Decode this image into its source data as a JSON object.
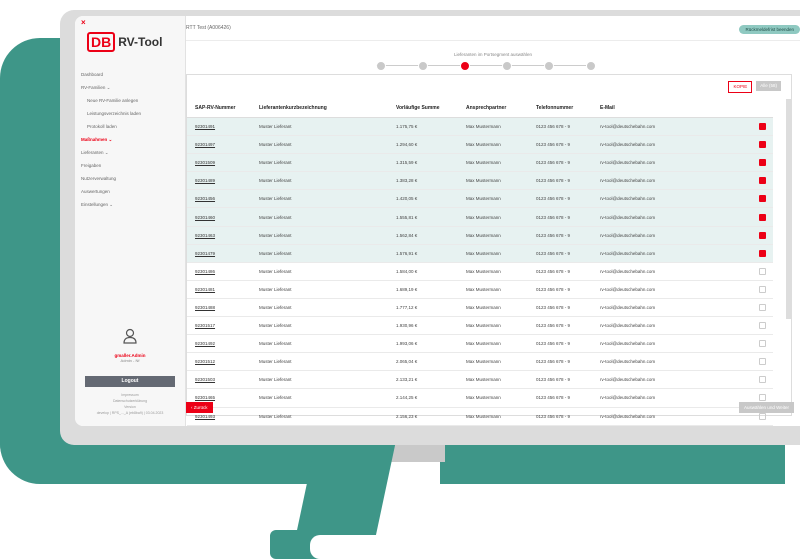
{
  "app": {
    "logo_mark": "DB",
    "logo_text": "RV-Tool",
    "close_glyph": "×"
  },
  "sidebar": {
    "items": [
      {
        "label": "Dashboard",
        "type": "main"
      },
      {
        "label": "RV-Familien ⌄",
        "type": "main"
      },
      {
        "label": "Neue RV-Familie anlegen",
        "type": "sub"
      },
      {
        "label": "Leistungsverzeichnis laden",
        "type": "sub"
      },
      {
        "label": "Protokoll laden",
        "type": "sub"
      },
      {
        "label": "Maßnahmen ⌄",
        "type": "active"
      },
      {
        "label": "Lieferanten ⌄",
        "type": "main"
      },
      {
        "label": "Freigaben",
        "type": "main"
      },
      {
        "label": "Nutzerverwaltung",
        "type": "main"
      },
      {
        "label": "Auswertungen",
        "type": "main"
      },
      {
        "label": "Einstellungen ⌄",
        "type": "main"
      }
    ],
    "user_name": "gmaller.Admin",
    "user_role": "Admin - Nf",
    "logout": "Logout",
    "footer_lines": [
      "Impressum",
      "Datenschutzerklärung",
      "Version",
      "develop | RPS_..._A (eb8ba9) | 03.04.2023"
    ]
  },
  "header": {
    "breadcrumb": "RTT Test (A006426)",
    "back_button": "Rückmeldefrist beenden"
  },
  "stepper": {
    "label": "Lieferanten im Portsegment auswählen",
    "active_step": 3,
    "total_steps": 6
  },
  "panel": {
    "btn_kopie": "KOPIE",
    "btn_alle": "Alle (58)"
  },
  "table": {
    "headers": [
      "SAP-RV-Nummer",
      "Lieferantenkurzbezeichnung",
      "Vorläufige Summe",
      "Ansprechpartner",
      "Telefonnummer",
      "E-Mail"
    ],
    "rows": [
      {
        "id": "92301491",
        "name": "Muster Lieferant",
        "sum": "1.175,75 €",
        "contact": "Max Mustermann",
        "phone": "0123 456 678 - 9",
        "email": "rv-tool@deutschebahn.com",
        "selected": true
      },
      {
        "id": "92301497",
        "name": "Muster Lieferant",
        "sum": "1.294,60 €",
        "contact": "Max Mustermann",
        "phone": "0123 456 678 - 9",
        "email": "rv-tool@deutschebahn.com",
        "selected": true
      },
      {
        "id": "92301509",
        "name": "Muster Lieferant",
        "sum": "1.315,59 €",
        "contact": "Max Mustermann",
        "phone": "0123 456 678 - 9",
        "email": "rv-tool@deutschebahn.com",
        "selected": true
      },
      {
        "id": "92301489",
        "name": "Muster Lieferant",
        "sum": "1.383,28 €",
        "contact": "Max Mustermann",
        "phone": "0123 456 678 - 9",
        "email": "rv-tool@deutschebahn.com",
        "selected": true
      },
      {
        "id": "92301456",
        "name": "Muster Lieferant",
        "sum": "1.420,05 €",
        "contact": "Max Mustermann",
        "phone": "0123 456 678 - 9",
        "email": "rv-tool@deutschebahn.com",
        "selected": true
      },
      {
        "id": "92301460",
        "name": "Muster Lieferant",
        "sum": "1.555,81 €",
        "contact": "Max Mustermann",
        "phone": "0123 456 678 - 9",
        "email": "rv-tool@deutschebahn.com",
        "selected": true
      },
      {
        "id": "92301463",
        "name": "Muster Lieferant",
        "sum": "1.562,84 €",
        "contact": "Max Mustermann",
        "phone": "0123 456 678 - 9",
        "email": "rv-tool@deutschebahn.com",
        "selected": true
      },
      {
        "id": "92301479",
        "name": "Muster Lieferant",
        "sum": "1.576,91 €",
        "contact": "Max Mustermann",
        "phone": "0123 456 678 - 9",
        "email": "rv-tool@deutschebahn.com",
        "selected": true
      },
      {
        "id": "92301486",
        "name": "Muster Lieferant",
        "sum": "1.584,00 €",
        "contact": "Max Mustermann",
        "phone": "0123 456 678 - 9",
        "email": "rv-tool@deutschebahn.com",
        "selected": false
      },
      {
        "id": "92301481",
        "name": "Muster Lieferant",
        "sum": "1.689,19 €",
        "contact": "Max Mustermann",
        "phone": "0123 456 678 - 9",
        "email": "rv-tool@deutschebahn.com",
        "selected": false
      },
      {
        "id": "92301488",
        "name": "Muster Lieferant",
        "sum": "1.777,12 €",
        "contact": "Max Mustermann",
        "phone": "0123 456 678 - 9",
        "email": "rv-tool@deutschebahn.com",
        "selected": false
      },
      {
        "id": "92301517",
        "name": "Muster Lieferant",
        "sum": "1.930,96 €",
        "contact": "Max Mustermann",
        "phone": "0123 456 678 - 9",
        "email": "rv-tool@deutschebahn.com",
        "selected": false
      },
      {
        "id": "92301492",
        "name": "Muster Lieferant",
        "sum": "1.993,06 €",
        "contact": "Max Mustermann",
        "phone": "0123 456 678 - 9",
        "email": "rv-tool@deutschebahn.com",
        "selected": false
      },
      {
        "id": "92301512",
        "name": "Muster Lieferant",
        "sum": "2.065,04 €",
        "contact": "Max Mustermann",
        "phone": "0123 456 678 - 9",
        "email": "rv-tool@deutschebahn.com",
        "selected": false
      },
      {
        "id": "92301503",
        "name": "Muster Lieferant",
        "sum": "2.133,21 €",
        "contact": "Max Mustermann",
        "phone": "0123 456 678 - 9",
        "email": "rv-tool@deutschebahn.com",
        "selected": false
      },
      {
        "id": "92301465",
        "name": "Muster Lieferant",
        "sum": "2.144,25 €",
        "contact": "Max Mustermann",
        "phone": "0123 456 678 - 9",
        "email": "rv-tool@deutschebahn.com",
        "selected": false
      },
      {
        "id": "92301493",
        "name": "Muster Lieferant",
        "sum": "2.156,23 €",
        "contact": "Max Mustermann",
        "phone": "0123 456 678 - 9",
        "email": "rv-tool@deutschebahn.com",
        "selected": false
      },
      {
        "id": "92301504",
        "name": "Muster Lieferant",
        "sum": "2.179,34 €",
        "contact": "Max Mustermann",
        "phone": "0123 456 678 - 9",
        "email": "rv-tool@deutschebahn.com",
        "selected": false
      }
    ]
  },
  "footer": {
    "back": "‹ Zurück",
    "next": "Auswählen und Weiter"
  },
  "colors": {
    "brand_red": "#ec0016",
    "teal": "#3e9688",
    "selected_row": "#e7f2f1"
  }
}
